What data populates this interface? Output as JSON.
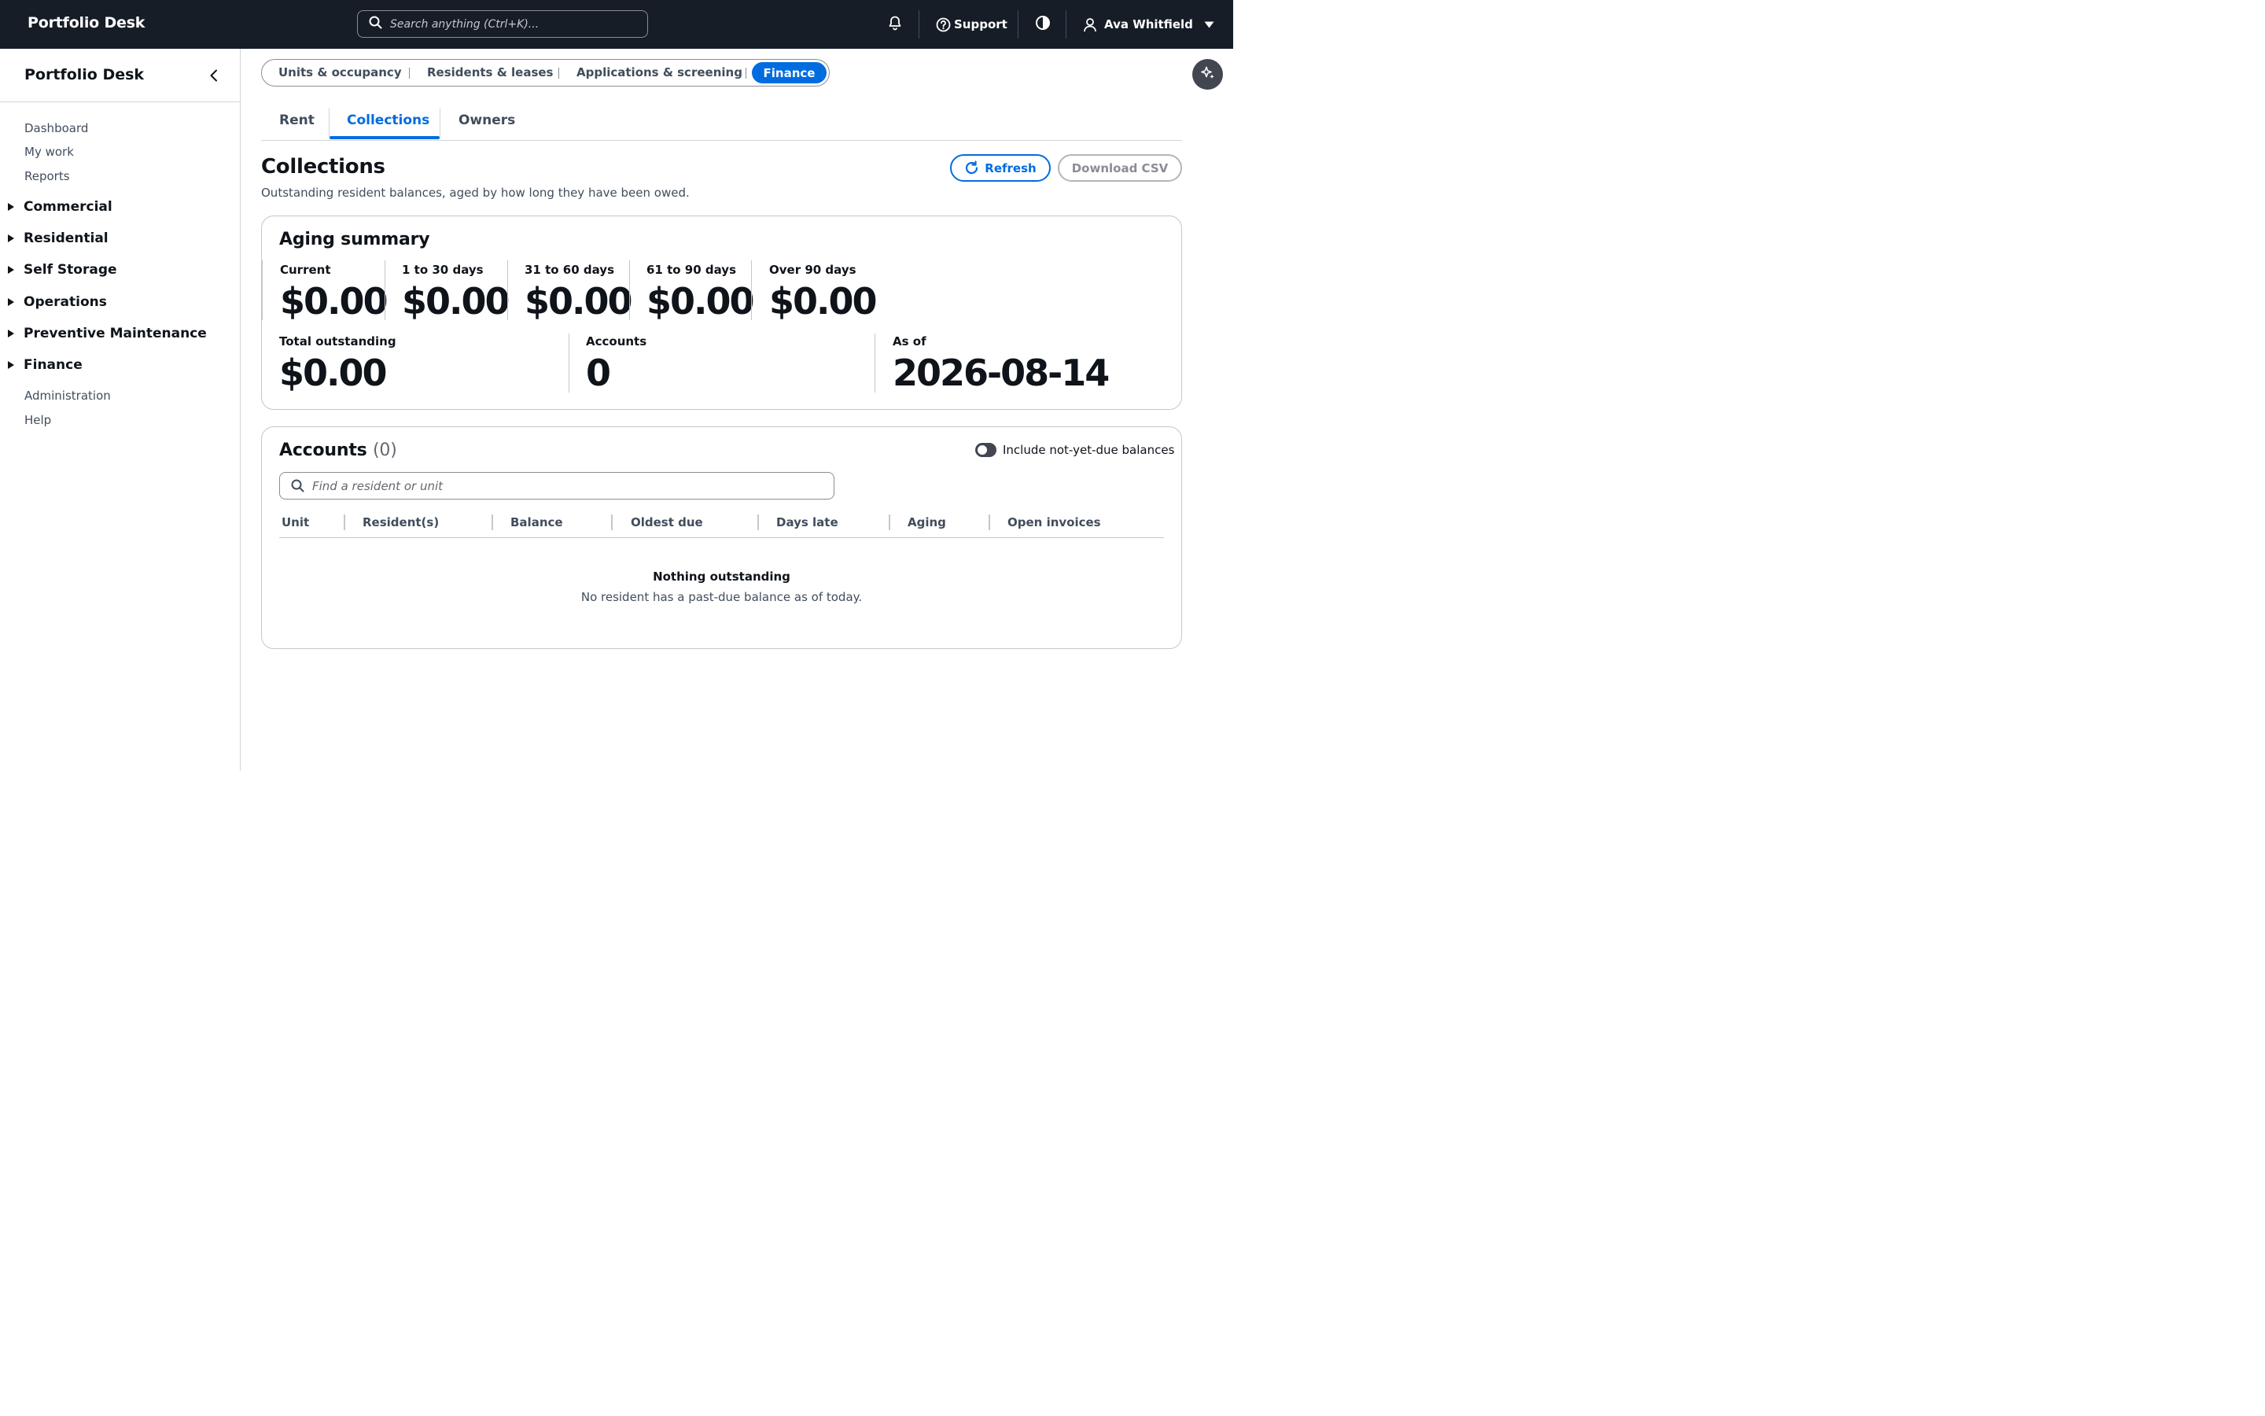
{
  "topbar": {
    "brand": "Portfolio Desk",
    "search_placeholder": "Search anything (Ctrl+K)...",
    "support_label": "Support",
    "user_name": "Ava Whitfield"
  },
  "sidebar": {
    "title": "Portfolio Desk",
    "top_links": [
      "Dashboard",
      "My work",
      "Reports"
    ],
    "groups": [
      "Commercial",
      "Residential",
      "Self Storage",
      "Operations",
      "Preventive Maintenance",
      "Finance"
    ],
    "bottom_links": [
      "Administration",
      "Help"
    ]
  },
  "segments": {
    "items": [
      "Units & occupancy",
      "Residents & leases",
      "Applications & screening",
      "Finance"
    ],
    "active": "Finance"
  },
  "tabs": {
    "items": [
      "Rent",
      "Collections",
      "Owners"
    ],
    "active": "Collections"
  },
  "page": {
    "title": "Collections",
    "description": "Outstanding resident balances, aged by how long they have been owed.",
    "refresh_label": "Refresh",
    "download_label": "Download CSV"
  },
  "aging": {
    "title": "Aging summary",
    "buckets": [
      {
        "label": "Current",
        "value": "$0.00"
      },
      {
        "label": "1 to 30 days",
        "value": "$0.00"
      },
      {
        "label": "31 to 60 days",
        "value": "$0.00"
      },
      {
        "label": "61 to 90 days",
        "value": "$0.00"
      },
      {
        "label": "Over 90 days",
        "value": "$0.00"
      }
    ],
    "totals": [
      {
        "label": "Total outstanding",
        "value": "$0.00"
      },
      {
        "label": "Accounts",
        "value": "0"
      },
      {
        "label": "As of",
        "value": "2026-08-14"
      }
    ]
  },
  "accounts": {
    "title": "Accounts",
    "count": "(0)",
    "toggle_label": "Include not-yet-due balances",
    "toggle_on": false,
    "search_placeholder": "Find a resident or unit",
    "columns": [
      "Unit",
      "Resident(s)",
      "Balance",
      "Oldest due",
      "Days late",
      "Aging",
      "Open invoices"
    ],
    "empty_title": "Nothing outstanding",
    "empty_message": "No resident has a past-due balance as of today."
  },
  "colors": {
    "topbar_bg": "#161d26",
    "accent": "#006ce0",
    "text": "#0f141a",
    "muted_text": "#414d5c"
  },
  "icons": {
    "search": "search-icon",
    "bell": "bell-icon",
    "support": "help-circle-icon",
    "theme": "contrast-icon",
    "user": "user-icon",
    "caret": "caret-down-icon",
    "collapse": "chevron-left-icon",
    "assistant": "sparkle-icon",
    "refresh": "refresh-icon"
  }
}
